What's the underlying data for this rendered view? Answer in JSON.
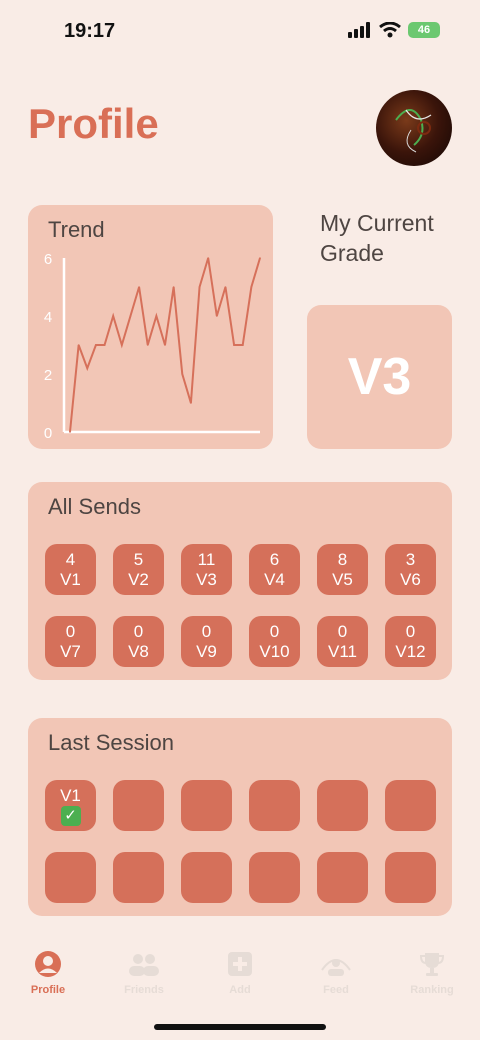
{
  "status_bar": {
    "time": "19:17",
    "battery": "46"
  },
  "header": {
    "title": "Profile"
  },
  "trend": {
    "title": "Trend",
    "chart_data": {
      "type": "line",
      "title": "Trend",
      "xlabel": "",
      "ylabel": "",
      "ylim": [
        0,
        6
      ],
      "yticks": [
        "0",
        "2",
        "4",
        "6"
      ],
      "values": [
        0,
        3,
        2.2,
        3,
        3,
        4,
        3,
        4,
        5,
        3,
        4,
        3,
        5,
        2,
        1,
        5,
        6,
        4,
        5,
        3,
        3,
        5,
        6
      ]
    }
  },
  "grade": {
    "label": "My Current Grade",
    "value": "V3"
  },
  "all_sends": {
    "title": "All Sends",
    "items": [
      {
        "count": "4",
        "grade": "V1"
      },
      {
        "count": "5",
        "grade": "V2"
      },
      {
        "count": "11",
        "grade": "V3"
      },
      {
        "count": "6",
        "grade": "V4"
      },
      {
        "count": "8",
        "grade": "V5"
      },
      {
        "count": "3",
        "grade": "V6"
      },
      {
        "count": "0",
        "grade": "V7"
      },
      {
        "count": "0",
        "grade": "V8"
      },
      {
        "count": "0",
        "grade": "V9"
      },
      {
        "count": "0",
        "grade": "V10"
      },
      {
        "count": "0",
        "grade": "V11"
      },
      {
        "count": "0",
        "grade": "V12"
      }
    ]
  },
  "last_session": {
    "title": "Last Session",
    "first_grade": "V1",
    "check": "✓"
  },
  "tabs": [
    {
      "label": "Profile",
      "icon": "person-circle-icon"
    },
    {
      "label": "Friends",
      "icon": "people-icon"
    },
    {
      "label": "Add",
      "icon": "plus-square-icon"
    },
    {
      "label": "Feed",
      "icon": "feed-icon"
    },
    {
      "label": "Ranking",
      "icon": "trophy-icon"
    }
  ],
  "colors": {
    "accent": "#d96f56",
    "tile": "#d5705a",
    "card": "#f2c6b6",
    "background": "#f9ece6"
  }
}
